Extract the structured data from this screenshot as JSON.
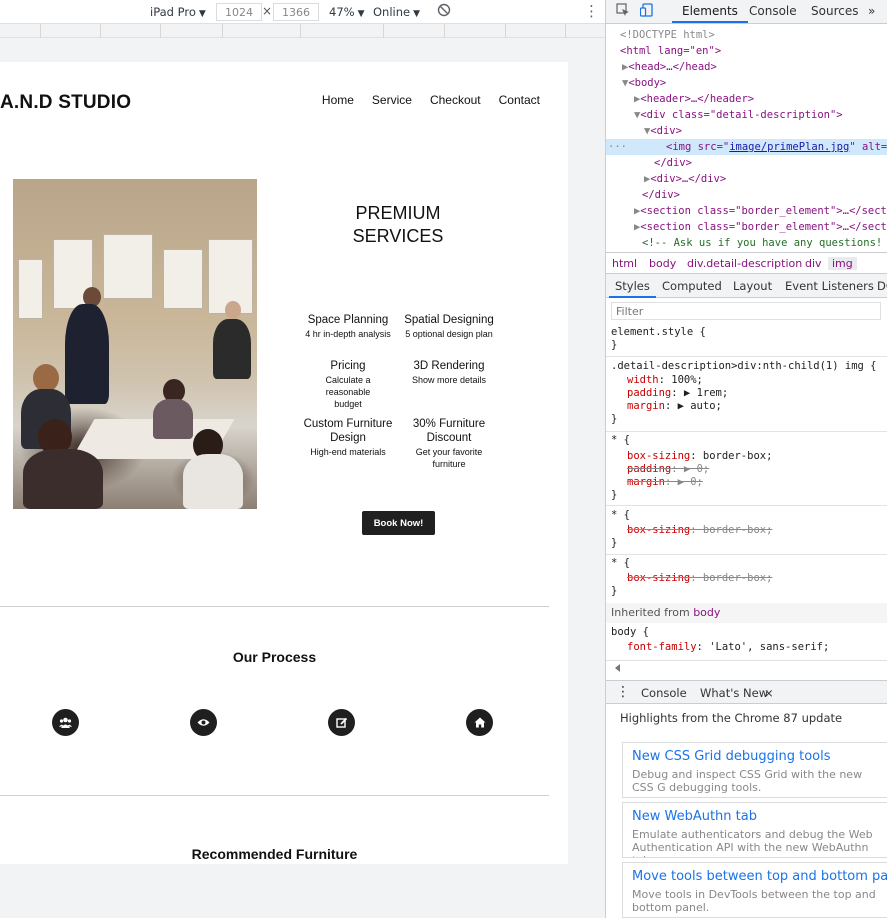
{
  "device_toolbar": {
    "device": "iPad Pro",
    "width": "1024",
    "height": "1366",
    "times": "×",
    "zoom": "47%",
    "network": "Online",
    "caret": "▼",
    "rotate_icon": "⃠",
    "more": "⋮"
  },
  "site": {
    "brand": "A.N.D STUDIO",
    "nav": [
      "Home",
      "Service",
      "Checkout",
      "Contact"
    ],
    "title_line1": "PREMIUM",
    "title_line2": "SERVICES",
    "features": [
      {
        "title": "Space Planning",
        "sub": "4 hr in-depth analysis"
      },
      {
        "title": "Spatial Designing",
        "sub": "5 optional design plan"
      },
      {
        "title": "Pricing",
        "sub": "Calculate a reasonable budget"
      },
      {
        "title": "3D Rendering",
        "sub": "Show more details"
      },
      {
        "title": "Custom Furniture Design",
        "sub": "High-end materials"
      },
      {
        "title": "30% Furniture Discount",
        "sub": "Get your favorite furniture"
      }
    ],
    "book_button": "Book Now!",
    "process_heading": "Our Process",
    "process_icons": [
      "users-icon",
      "eye-icon",
      "edit-icon",
      "home-icon"
    ],
    "recommended_heading": "Recommended Furniture"
  },
  "devtools": {
    "tabs": [
      "Elements",
      "Console",
      "Sources"
    ],
    "more_tabs": "»",
    "dom": {
      "doctype": "<!DOCTYPE html>",
      "html_open": "<html lang=\"en\">",
      "head": "<head>…</head>",
      "body_open": "<body>",
      "header": "<header>…</header>",
      "div_open": "<div class=\"detail-description\">",
      "inner_div": "<div>",
      "img_pre": "<img src=\"",
      "img_src": "image/primePlan.jpg",
      "img_post": "\" alt=\"",
      "div_close": "</div>",
      "div_collapsed": "<div>…</div>",
      "div_close2": "</div>",
      "section1": "<section class=\"border_element\">…</secti",
      "section2": "<section class=\"border_element\">…</secti",
      "comment": "<!-- Ask us if you have any questions! -",
      "ellipsis": "···"
    },
    "breadcrumbs": [
      "html",
      "body",
      "div.detail-description",
      "div",
      "img"
    ],
    "subtabs": [
      "Styles",
      "Computed",
      "Layout",
      "Event Listeners",
      "DO"
    ],
    "filter_placeholder": "Filter",
    "styles": {
      "element_style": "element.style {",
      "close": "}",
      "rule1_selector": ".detail-description>div:nth-child(1) img {",
      "rule1_props": [
        {
          "name": "width",
          "value": "100%;"
        },
        {
          "name": "padding",
          "value": "▶ 1rem;"
        },
        {
          "name": "margin",
          "value": "▶ auto;"
        }
      ],
      "star": "* {",
      "box_sizing": {
        "name": "box-sizing",
        "value": "border-box;"
      },
      "padding_struck": {
        "name": "padding",
        "value": "▶ 0;"
      },
      "margin_struck": {
        "name": "margin",
        "value": "▶ 0;"
      },
      "inherited_label": "Inherited from",
      "inherited_from": "body",
      "body_selector": "body {",
      "font_family": {
        "name": "font-family",
        "value": "'Lato', sans-serif;"
      }
    },
    "drawer_tabs": [
      "Console",
      "What's New"
    ],
    "drawer_close": "×",
    "highlights": "Highlights from the Chrome 87 update",
    "cards": [
      {
        "title": "New CSS Grid debugging tools",
        "desc": "Debug and inspect CSS Grid with the new CSS G debugging tools."
      },
      {
        "title": "New WebAuthn tab",
        "desc": "Emulate authenticators and debug the Web Authentication API with the new WebAuthn tab."
      },
      {
        "title": "Move tools between top and bottom panel",
        "desc": "Move tools in DevTools between the top and bottom panel."
      }
    ]
  }
}
